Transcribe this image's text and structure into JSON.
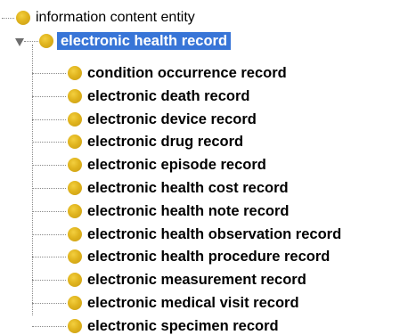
{
  "tree": {
    "root": {
      "label": "information content entity"
    },
    "parent": {
      "label": "electronic health record",
      "expanded": true,
      "selected": true
    },
    "children": [
      {
        "label": "condition occurrence record"
      },
      {
        "label": "electronic death record"
      },
      {
        "label": "electronic device record"
      },
      {
        "label": "electronic drug record"
      },
      {
        "label": "electronic episode record"
      },
      {
        "label": "electronic health cost record"
      },
      {
        "label": "electronic health note record"
      },
      {
        "label": "electronic health observation record"
      },
      {
        "label": "electronic health procedure record"
      },
      {
        "label": "electronic measurement record"
      },
      {
        "label": "electronic medical visit record"
      },
      {
        "label": "electronic specimen record"
      }
    ]
  },
  "colors": {
    "bullet": "#e0b41e",
    "selection": "#3875d7",
    "connector": "#8a8a8a"
  },
  "icons": {
    "bullet": "class-bullet-icon",
    "toggle": "expand-toggle-icon"
  }
}
